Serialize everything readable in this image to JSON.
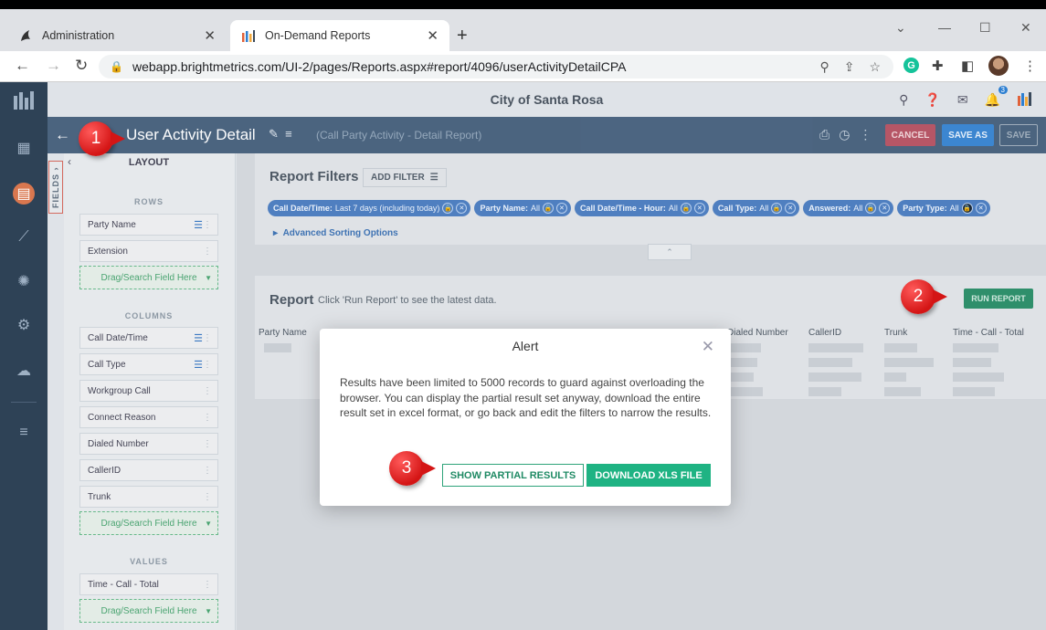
{
  "browser": {
    "tabs": [
      {
        "label": "Administration",
        "active": false,
        "icon": "phoenix-icon"
      },
      {
        "label": "On-Demand Reports",
        "active": true,
        "icon": "brightmetrics-icon"
      }
    ],
    "url": "webapp.brightmetrics.com/UI-2/pages/Reports.aspx#report/4096/userActivityDetailCPA",
    "grammarly_letter": "G"
  },
  "app": {
    "org_name": "City of Santa Rosa",
    "notification_count": "3",
    "report_title": "User Activity Detail",
    "report_subtitle": "(Call Party Activity - Detail Report)",
    "buttons": {
      "cancel": "CANCEL",
      "save_as": "SAVE AS",
      "save": "SAVE"
    },
    "fields_tab": "FIELDS",
    "layout": {
      "heading": "LAYOUT",
      "rows_label": "ROWS",
      "rows": [
        "Party Name",
        "Extension"
      ],
      "columns_label": "COLUMNS",
      "columns": [
        "Call Date/Time",
        "Call Type",
        "Workgroup Call",
        "Connect Reason",
        "Dialed Number",
        "CallerID",
        "Trunk"
      ],
      "values_label": "VALUES",
      "values": [
        "Time - Call - Total"
      ],
      "drop_hint": "Drag/Search Field Here"
    },
    "filters": {
      "title": "Report Filters",
      "add_filter": "ADD FILTER",
      "chips": [
        {
          "name": "Call Date/Time:",
          "value": "Last 7 days (including today)"
        },
        {
          "name": "Party Name:",
          "value": "All"
        },
        {
          "name": "Call Date/Time - Hour:",
          "value": "All"
        },
        {
          "name": "Call Type:",
          "value": "All"
        },
        {
          "name": "Answered:",
          "value": "All"
        },
        {
          "name": "Party Type:",
          "value": "All"
        }
      ],
      "advanced": "Advanced Sorting Options"
    },
    "report": {
      "title": "Report",
      "hint": "Click 'Run Report' to see the latest data.",
      "run_button": "RUN REPORT",
      "column_headers": [
        "Party Name",
        "Dialed Number",
        "CallerID",
        "Trunk",
        "Time - Call - Total"
      ]
    }
  },
  "modal": {
    "title": "Alert",
    "body": "Results have been limited to 5000 records to guard against overloading the browser. You can display the partial result set anyway, download the entire result set in excel format, or go back and edit the filters to narrow the results.",
    "show_partial": "SHOW PARTIAL RESULTS",
    "download_xls": "DOWNLOAD XLS FILE"
  },
  "callouts": [
    "1",
    "2",
    "3"
  ],
  "colors": {
    "nav_bg": "#2e4256",
    "titlebar_bg": "#3f5a77",
    "accent_green": "#1fb383",
    "callout_red": "#d41515",
    "chip_blue": "#4f7fc0"
  }
}
